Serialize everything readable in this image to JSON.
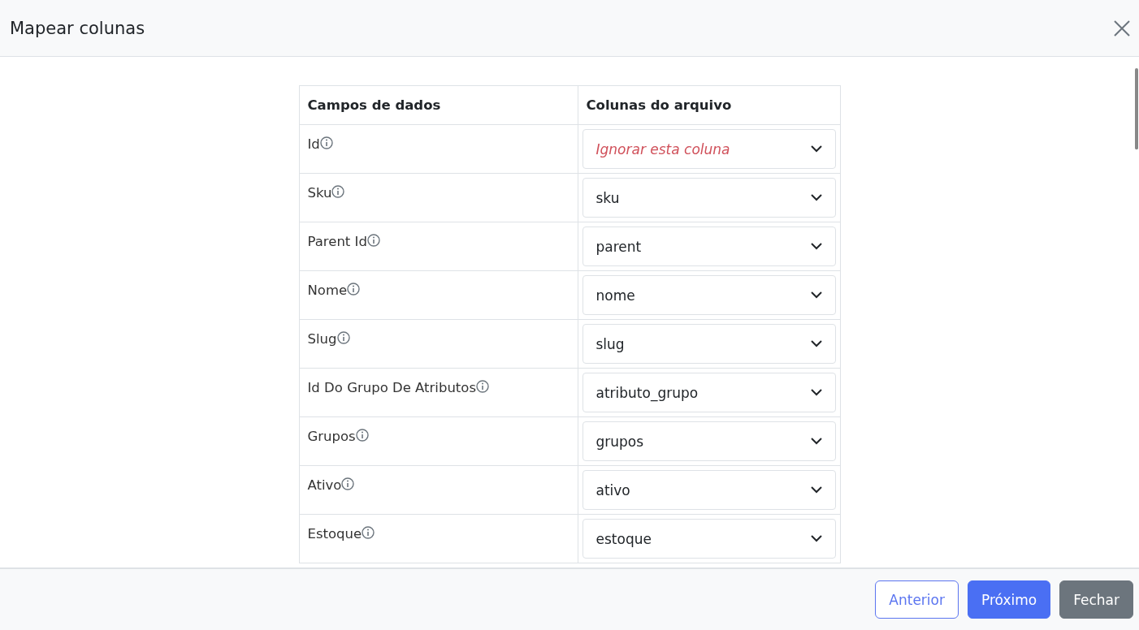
{
  "dialog": {
    "title": "Mapear colunas"
  },
  "table": {
    "columns": [
      "Campos de dados",
      "Colunas do arquivo"
    ],
    "rows": [
      {
        "field": "Id",
        "value": "Ignorar esta coluna",
        "ignored": true
      },
      {
        "field": "Sku",
        "value": "sku",
        "ignored": false
      },
      {
        "field": "Parent Id",
        "value": "parent",
        "ignored": false
      },
      {
        "field": "Nome",
        "value": "nome",
        "ignored": false
      },
      {
        "field": "Slug",
        "value": "slug",
        "ignored": false
      },
      {
        "field": "Id Do Grupo De Atributos",
        "value": "atributo_grupo",
        "ignored": false
      },
      {
        "field": "Grupos",
        "value": "grupos",
        "ignored": false
      },
      {
        "field": "Ativo",
        "value": "ativo",
        "ignored": false
      },
      {
        "field": "Estoque",
        "value": "estoque",
        "ignored": false
      }
    ]
  },
  "buttons": [
    {
      "label": "Anterior",
      "kind": "outline"
    },
    {
      "label": "Próximo",
      "kind": "primary"
    },
    {
      "label": "Fechar",
      "kind": "secondary"
    }
  ]
}
